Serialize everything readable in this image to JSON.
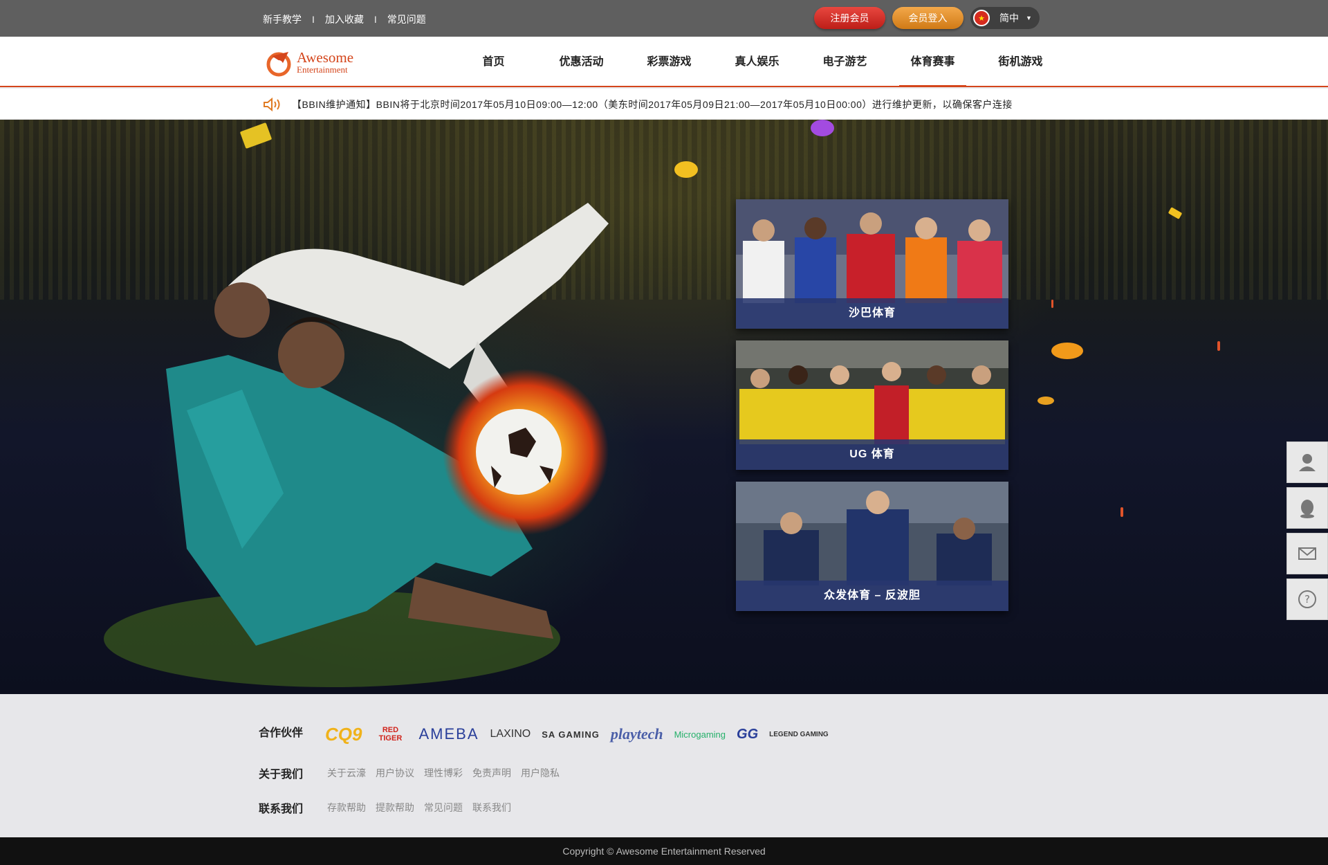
{
  "topbar": {
    "links": [
      "新手教学",
      "加入收藏",
      "常见问题"
    ],
    "separator": "I",
    "register_label": "注册会员",
    "login_label": "会员登入",
    "language": "简中"
  },
  "header": {
    "logo_line1": "Awesome",
    "logo_line2": "Entertainment",
    "nav": [
      "首页",
      "优惠活动",
      "彩票游戏",
      "真人娱乐",
      "电子游艺",
      "体育赛事",
      "街机游戏"
    ],
    "active_nav": "体育赛事"
  },
  "notice": {
    "text": "【BBIN维护通知】BBIN将于北京时间2017年05月10日09:00—12:00（美东时间2017年05月09日21:00—2017年05月10日00:00）进行维护更新，以确保客户连接"
  },
  "hero": {
    "cards": [
      {
        "label": "沙巴体育"
      },
      {
        "label": "UG 体育"
      },
      {
        "label": "众发体育 – 反波胆"
      }
    ]
  },
  "side_tools": [
    "user-icon",
    "qq-icon",
    "mail-icon",
    "help-icon"
  ],
  "footer": {
    "partners_label": "合作伙伴",
    "partners": [
      "CQ9",
      "RED TIGER",
      "AMEBA",
      "LAXINO",
      "SA GAMING",
      "playtech",
      "Microgaming",
      "GG",
      "LEGEND GAMING"
    ],
    "about_label": "关于我们",
    "about_links": [
      "关于云濠",
      "用户协议",
      "理性博彩",
      "免责声明",
      "用户隐私"
    ],
    "contact_label": "联系我们",
    "contact_links": [
      "存款帮助",
      "提款帮助",
      "常见问题",
      "联系我们"
    ],
    "copyright": "Copyright © Awesome Entertainment Reserved"
  },
  "colors": {
    "brand": "#d4451b",
    "topbar": "#5f5f5f",
    "register": "#d3302a",
    "login": "#e2922f",
    "card_label_bg": "#28376e"
  }
}
